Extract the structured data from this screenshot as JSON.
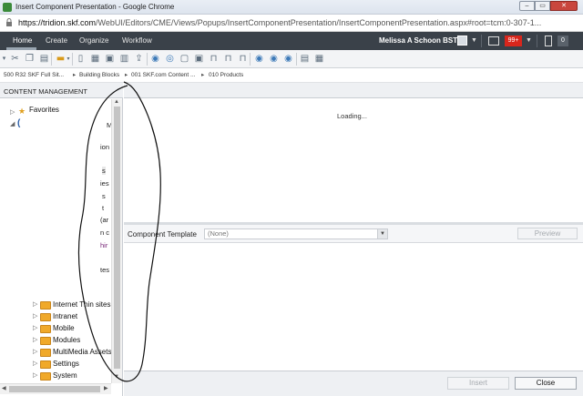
{
  "browser": {
    "window_title": "Insert Component Presentation - Google Chrome",
    "url_host": "https://tridion.skf.com",
    "url_path": "/WebUI/Editors/CME/Views/Popups/InsertComponentPresentation/InsertComponentPresentation.aspx#root=tcm:0-307-1..."
  },
  "appnav": {
    "items": [
      "Home",
      "Create",
      "Organize",
      "Workflow"
    ],
    "user_name": "Melissa A Schoon BST",
    "notifications_badge": "99+",
    "tasks_count": "0"
  },
  "toolbar": {
    "icons": [
      "cut-icon",
      "copy-icon",
      "paste-icon",
      "new-folder-icon",
      "new-item-icon",
      "edit-icon",
      "save-icon",
      "delete-icon",
      "check-in-icon",
      "publish-icon",
      "unpublish-icon",
      "localize-icon",
      "unlocalize-icon",
      "lock-icon",
      "unlock-icon",
      "lock-user-icon",
      "world-icon",
      "world2-icon",
      "world3-icon",
      "properties-icon",
      "info-icon"
    ]
  },
  "breadcrumb": [
    "500 R32 SKF Full Sit...",
    "Building Blocks",
    "001 SKF.com Content ...",
    "010 Products"
  ],
  "left_panel": {
    "header": "CONTENT MANAGEMENT",
    "favorites_label": "Favorites",
    "fragments": [
      "M",
      "ion",
      "s",
      "ies",
      "s",
      "t",
      "(ar",
      "n c",
      "hir",
      "tes"
    ],
    "tree_items": [
      "Internet Thin sites",
      "Intranet",
      "Mobile",
      "Modules",
      "MultiMedia Assets",
      "Settings",
      "System"
    ]
  },
  "preview": {
    "loading_text": "Loading..."
  },
  "component_template": {
    "label": "Component Template",
    "selected": "(None)",
    "preview_button": "Preview"
  },
  "footer": {
    "insert_button": "Insert",
    "close_button": "Close"
  }
}
